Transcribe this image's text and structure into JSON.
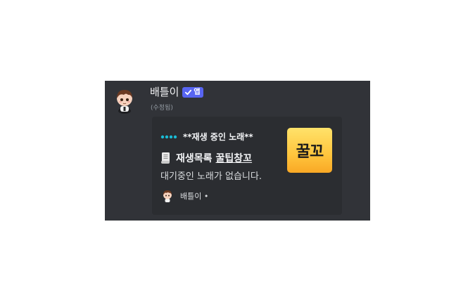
{
  "message": {
    "author": "배틀이",
    "app_badge": "앱",
    "edited_label": "(수정됨)"
  },
  "embed": {
    "header": "**재생 중인 노래**",
    "title_prefix": "재생목록",
    "title_link": "꿀팁창꼬",
    "description": "대기중인 노래가 없습니다.",
    "footer": "배틀이 •",
    "thumbnail_text": "꿀꼬"
  },
  "colors": {
    "panel_bg": "#313338",
    "embed_bg": "#2b2d31",
    "badge_bg": "#5865f2",
    "dots": "#1abcd6",
    "thumbnail": "#ffc53d"
  },
  "icons": {
    "header_icon": "typing-dots-icon",
    "title_icon": "scroll-icon",
    "badge_icon": "check-icon"
  }
}
